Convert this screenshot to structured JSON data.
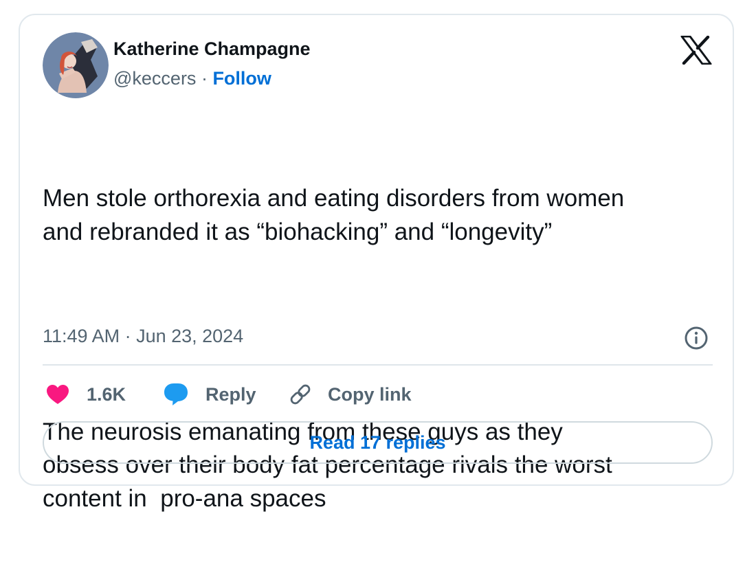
{
  "author": {
    "name": "Katherine Champagne",
    "handle": "@keccers",
    "separator": " · ",
    "follow_label": "Follow"
  },
  "tweet": {
    "paragraph_1": "Men stole orthorexia and eating disorders from women\nand rebranded it as “biohacking” and “longevity”",
    "paragraph_2": "The neurosis emanating from these guys as they\nobsess over their body fat percentage rivals the worst\ncontent in  pro-ana spaces",
    "timestamp": "11:49 AM · Jun 23, 2024"
  },
  "actions": {
    "like_count": "1.6K",
    "reply_label": "Reply",
    "copy_link_label": "Copy link",
    "read_replies_label": "Read 17 replies"
  },
  "icons": {
    "brand": "x-logo-icon",
    "info": "info-icon",
    "like": "heart-icon",
    "reply": "speech-bubble-icon",
    "copy": "link-icon"
  },
  "colors": {
    "text": "#0f1419",
    "secondary": "#536471",
    "link": "#006fd6",
    "heart": "#f91880",
    "reply": "#1d9bf0",
    "border": "#e1e8ed"
  }
}
